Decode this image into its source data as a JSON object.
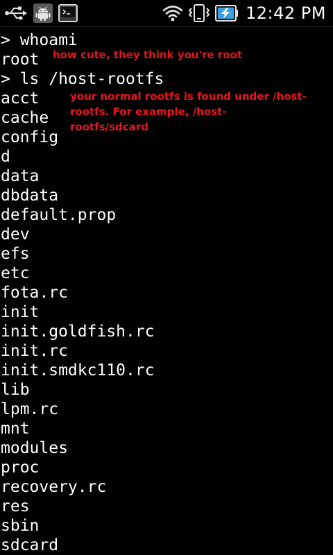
{
  "status_bar": {
    "time": "12:42 PM",
    "left_icons": [
      "usb-icon",
      "android-debug-icon",
      "terminal-app-icon"
    ],
    "right_icons": [
      "wifi-icon",
      "vibrate-icon",
      "battery-charging-icon"
    ]
  },
  "terminal": {
    "lines": [
      "> whoami",
      "root",
      "> ls /host-rootfs",
      "acct",
      "cache",
      "config",
      "d",
      "data",
      "dbdata",
      "default.prop",
      "dev",
      "efs",
      "etc",
      "fota.rc",
      "init",
      "init.goldfish.rc",
      "init.rc",
      "init.smdkc110.rc",
      "lib",
      "lpm.rc",
      "mnt",
      "modules",
      "proc",
      "recovery.rc",
      "res",
      "sbin",
      "sdcard"
    ]
  },
  "annotations": {
    "root_note": "how cute, they think you're root",
    "rootfs_note_line1": "your normal rootfs is found under /host-",
    "rootfs_note_line2": "rootfs.  For example, /host-",
    "rootfs_note_line3": "rootfs/sdcard"
  },
  "colors": {
    "background": "#000000",
    "text": "#ffffff",
    "annotation": "#e8161c",
    "battery_fill": "#3aa0e6"
  }
}
